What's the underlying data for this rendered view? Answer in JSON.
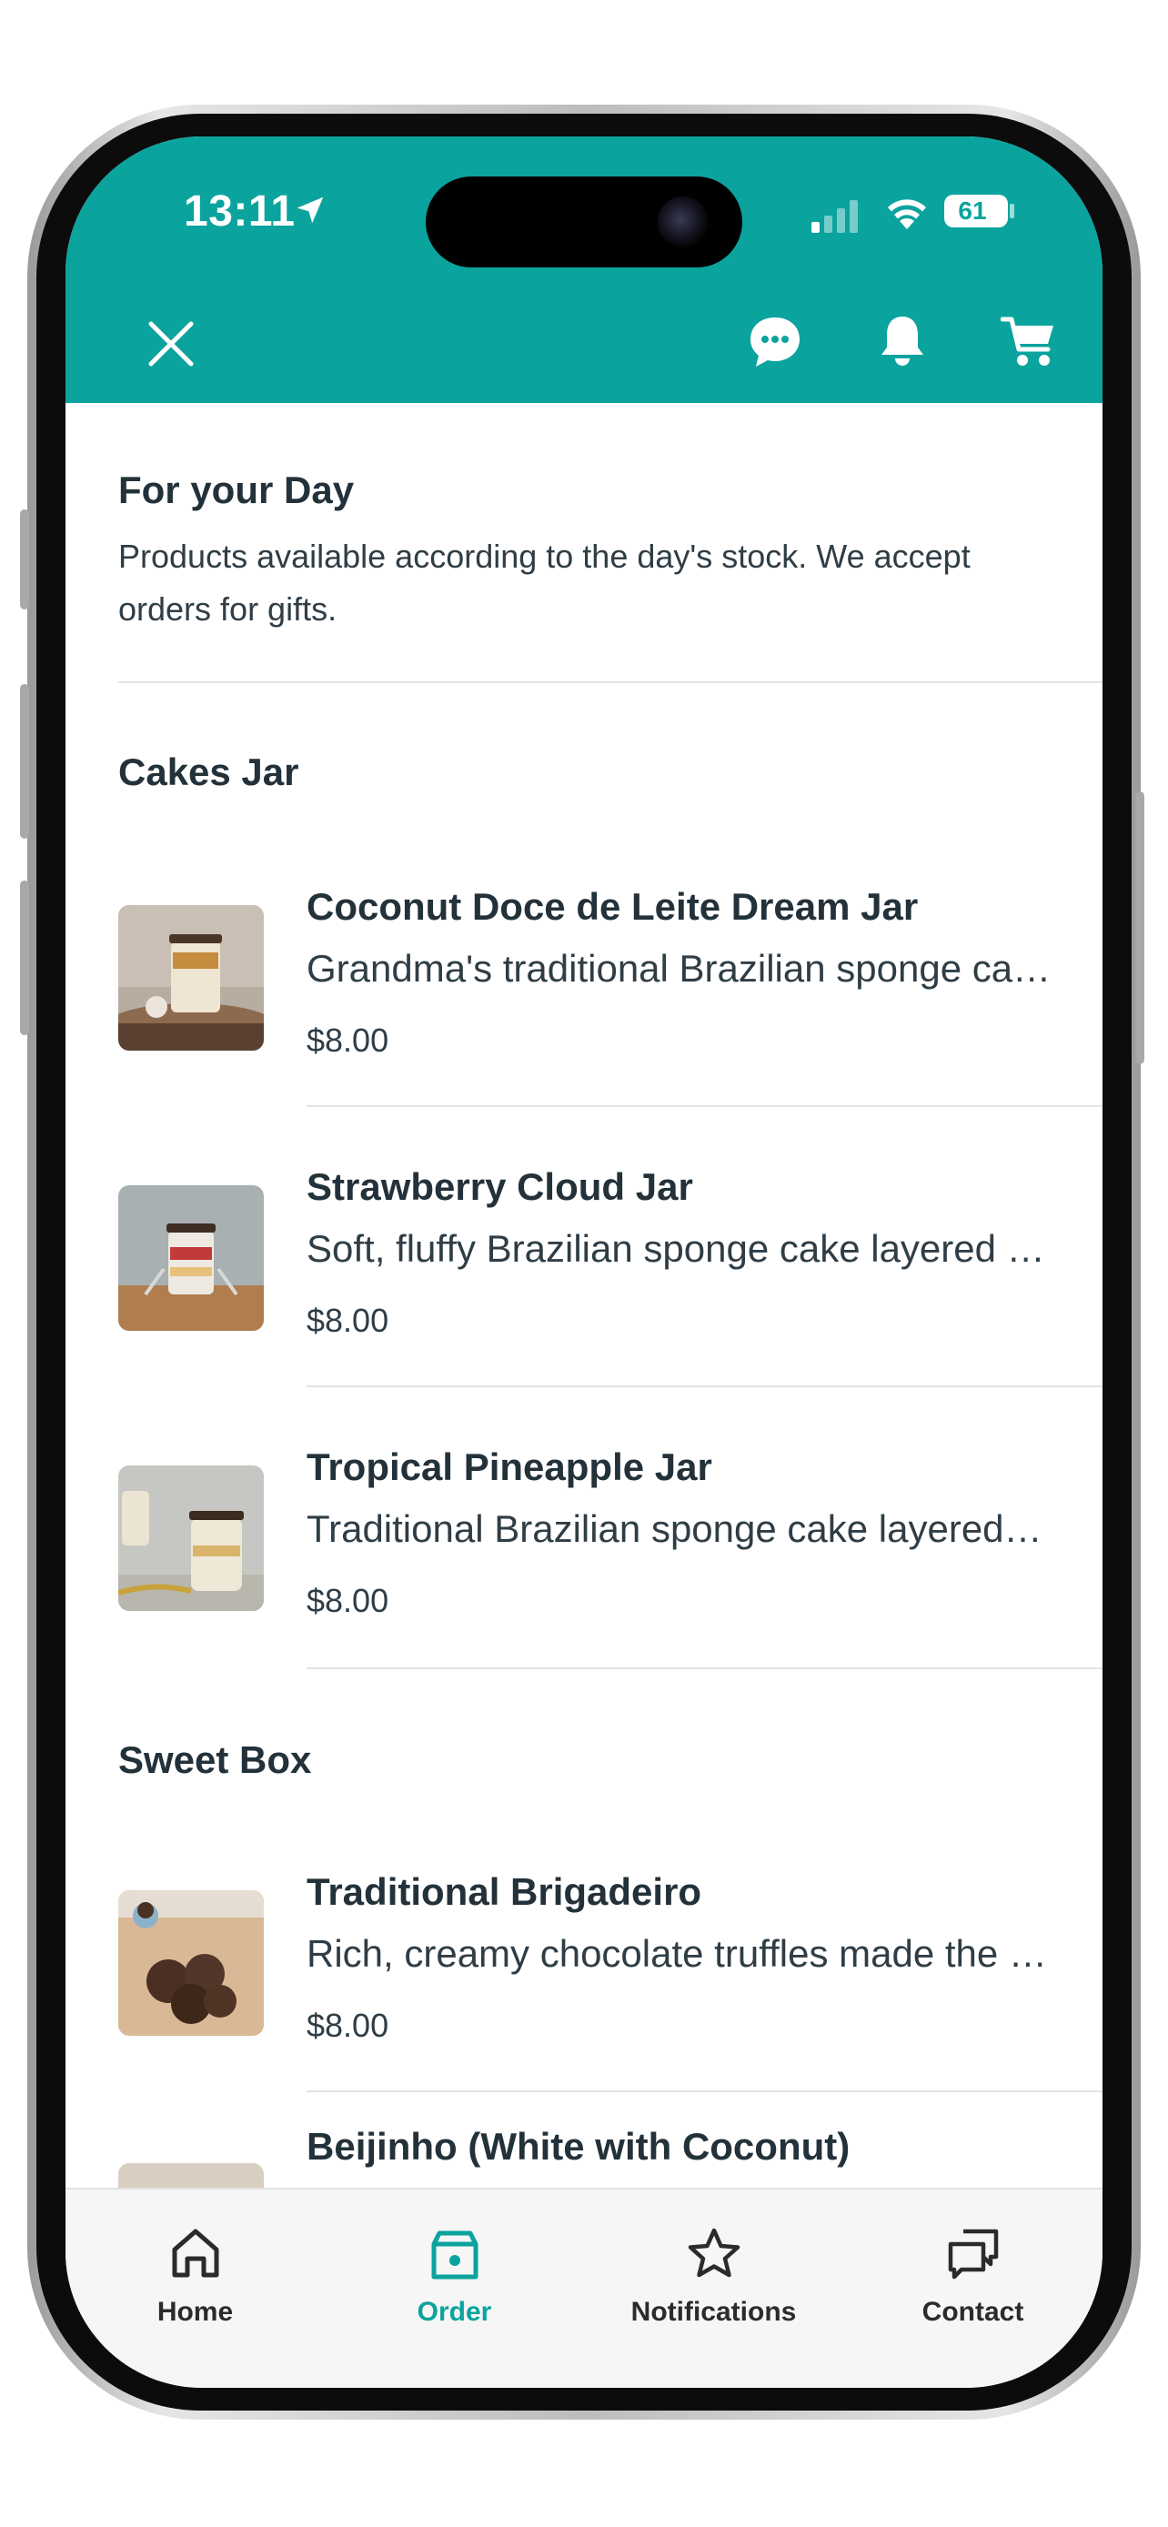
{
  "status_bar": {
    "time": "13:11",
    "battery": "61"
  },
  "colors": {
    "accent": "#0ba39e",
    "text_dark": "#23313a"
  },
  "header": {
    "close_icon": "close-icon",
    "chat_icon": "chat-bubble-icon",
    "bell_icon": "bell-icon",
    "cart_icon": "cart-icon"
  },
  "intro": {
    "title": "For your Day",
    "description": "Products available according to the day's stock. We accept orders for gifts."
  },
  "sections": [
    {
      "title": "Cakes Jar",
      "products": [
        {
          "name": "Coconut Doce de Leite Dream Jar",
          "description": "Grandma's traditional Brazilian sponge cake layered",
          "price": "$8.00"
        },
        {
          "name": "Strawberry Cloud Jar",
          "description": "Soft, fluffy Brazilian sponge cake layered with",
          "price": "$8.00"
        },
        {
          "name": "Tropical Pineapple Jar",
          "description": "Traditional Brazilian sponge cake layered with",
          "price": "$8.00"
        }
      ]
    },
    {
      "title": "Sweet Box",
      "products": [
        {
          "name": "Traditional Brigadeiro",
          "description": "Rich, creamy chocolate truffles made the traditional way",
          "price": "$8.00"
        },
        {
          "name": "Beijinho (White with Coconut)"
        }
      ]
    }
  ],
  "tabbar": {
    "items": [
      {
        "label": "Home",
        "icon": "home-icon"
      },
      {
        "label": "Order",
        "icon": "order-bag-icon",
        "active": true
      },
      {
        "label": "Notifications",
        "icon": "star-icon"
      },
      {
        "label": "Contact",
        "icon": "chat-bubbles-icon"
      }
    ]
  }
}
